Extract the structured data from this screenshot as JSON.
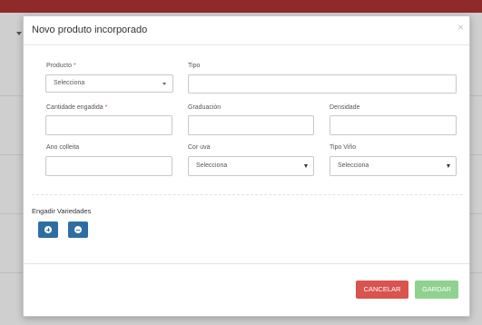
{
  "modal": {
    "title": "Novo produto incorporado",
    "close": "×"
  },
  "form": {
    "producto_label": "Producto",
    "required_mark": "*",
    "producto_value": "Selecciona",
    "tipo_label": "Tipo",
    "tipo_value": "",
    "cantidade_label": "Cantidade engadida",
    "cantidade_value": "",
    "graduacion_label": "Graduación",
    "graduacion_value": "",
    "densidade_label": "Densidade",
    "densidade_value": "",
    "ano_label": "Ano colleita",
    "ano_value": "",
    "cor_label": "Cor uva",
    "cor_value": "Selecciona",
    "tipovino_label": "Tipo Viño",
    "tipovino_value": "Selecciona"
  },
  "variedades": {
    "title": "Engadir Variedades",
    "add_icon": "plus-circle-icon",
    "remove_icon": "minus-circle-icon"
  },
  "footer": {
    "cancel": "CANCELAR",
    "save": "GARDAR"
  },
  "colors": {
    "cancel": "#d9534f",
    "save": "#8fd18f",
    "primary": "#2e6da4",
    "topbar": "#8e2a2a"
  }
}
